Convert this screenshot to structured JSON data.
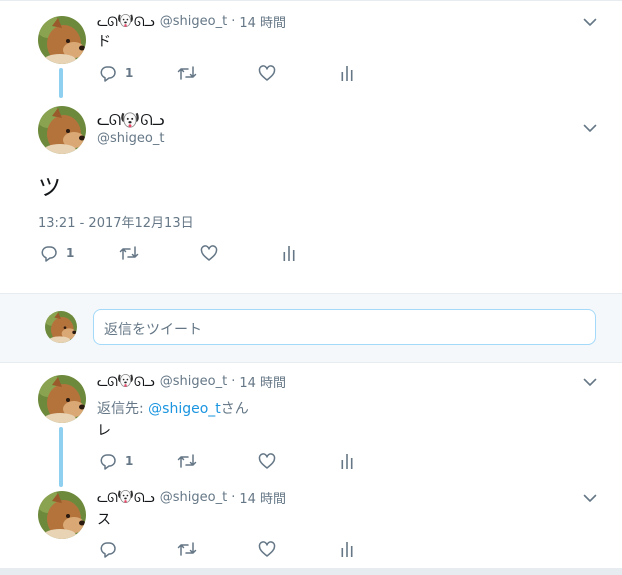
{
  "colors": {
    "thread_line": "#8fcff0",
    "link": "#1b95e0",
    "muted": "#657786",
    "text": "#14171a"
  },
  "tweets": [
    {
      "name_glyphs": "ᓚᘏ",
      "name_glyphs_right": "ᘏᓗ",
      "handle": "@shigeo_t",
      "time": "14 時間",
      "text": "ド",
      "reply_count": "1"
    },
    {
      "name_glyphs": "ᓚᘏ",
      "name_glyphs_right": "ᘏᓗ",
      "handle": "@shigeo_t",
      "text": "ツ",
      "timestamp": "13:21 - 2017年12月13日",
      "reply_count": "1"
    },
    {
      "name_glyphs": "ᓚᘏ",
      "name_glyphs_right": "ᘏᓗ",
      "handle": "@shigeo_t",
      "time": "14 時間",
      "reply_to_label": "返信先: ",
      "reply_to_handle": "@shigeo_t",
      "reply_to_suffix": "さん",
      "text": "レ",
      "reply_count": "1"
    },
    {
      "name_glyphs": "ᓚᘏ",
      "name_glyphs_right": "ᘏᓗ",
      "handle": "@shigeo_t",
      "time": "14 時間",
      "text": "ス",
      "reply_count": ""
    }
  ],
  "reply_box": {
    "placeholder": "返信をツイート"
  },
  "icons": [
    "reply-icon",
    "retweet-icon",
    "like-icon",
    "analytics-icon",
    "chevron-down-icon",
    "dog-emoji-icon"
  ]
}
